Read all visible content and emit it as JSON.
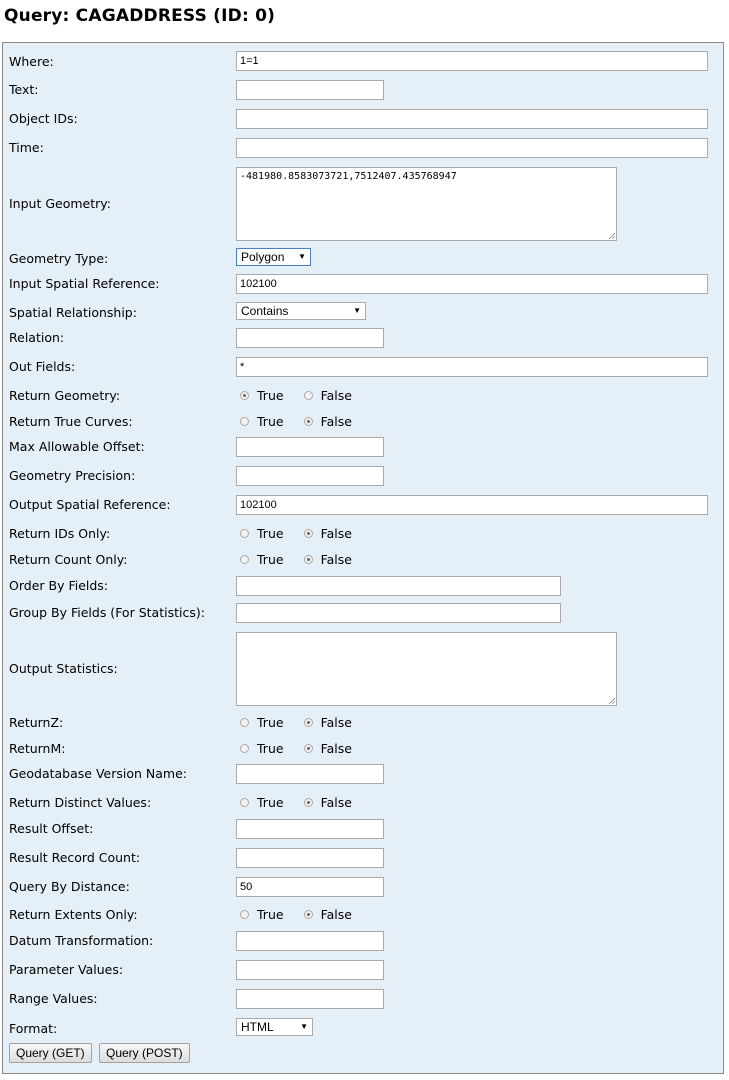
{
  "page": {
    "title": "Query: CAGADDRESS (ID: 0)"
  },
  "form": {
    "where": {
      "label": "Where:",
      "value": "1=1"
    },
    "text": {
      "label": "Text:",
      "value": ""
    },
    "object_ids": {
      "label": "Object IDs:",
      "value": ""
    },
    "time": {
      "label": "Time:",
      "value": ""
    },
    "input_geometry": {
      "label": "Input Geometry:",
      "value": "-481980.8583073721,7512407.435768947"
    },
    "geometry_type": {
      "label": "Geometry Type:",
      "selected": "Polygon"
    },
    "input_spatial_reference": {
      "label": "Input Spatial Reference:",
      "value": "102100"
    },
    "spatial_relationship": {
      "label": "Spatial Relationship:",
      "selected": "Contains"
    },
    "relation": {
      "label": "Relation:",
      "value": ""
    },
    "out_fields": {
      "label": "Out Fields:",
      "value": "*"
    },
    "return_geometry": {
      "label": "Return Geometry:",
      "true_label": "True",
      "false_label": "False",
      "selected": "True"
    },
    "return_true_curves": {
      "label": "Return True Curves:",
      "true_label": "True",
      "false_label": "False",
      "selected": "False"
    },
    "max_allowable_offset": {
      "label": "Max Allowable Offset:",
      "value": ""
    },
    "geometry_precision": {
      "label": "Geometry Precision:",
      "value": ""
    },
    "output_spatial_reference": {
      "label": "Output Spatial Reference:",
      "value": "102100"
    },
    "return_ids_only": {
      "label": "Return IDs Only:",
      "true_label": "True",
      "false_label": "False",
      "selected": "False"
    },
    "return_count_only": {
      "label": "Return Count Only:",
      "true_label": "True",
      "false_label": "False",
      "selected": "False"
    },
    "order_by_fields": {
      "label": "Order By Fields:",
      "value": ""
    },
    "group_by_fields": {
      "label": "Group By Fields (For Statistics):",
      "value": ""
    },
    "output_statistics": {
      "label": "Output Statistics:",
      "value": ""
    },
    "return_z": {
      "label": "ReturnZ:",
      "true_label": "True",
      "false_label": "False",
      "selected": "False"
    },
    "return_m": {
      "label": "ReturnM:",
      "true_label": "True",
      "false_label": "False",
      "selected": "False"
    },
    "gdb_version": {
      "label": "Geodatabase Version Name:",
      "value": ""
    },
    "return_distinct_values": {
      "label": "Return Distinct Values:",
      "true_label": "True",
      "false_label": "False",
      "selected": "False"
    },
    "result_offset": {
      "label": "Result Offset:",
      "value": ""
    },
    "result_record_count": {
      "label": "Result Record Count:",
      "value": ""
    },
    "query_by_distance": {
      "label": "Query By Distance:",
      "value": "50"
    },
    "return_extents_only": {
      "label": "Return Extents Only:",
      "true_label": "True",
      "false_label": "False",
      "selected": "False"
    },
    "datum_transformation": {
      "label": "Datum Transformation:",
      "value": ""
    },
    "parameter_values": {
      "label": "Parameter Values:",
      "value": ""
    },
    "range_values": {
      "label": "Range Values:",
      "value": ""
    },
    "format": {
      "label": "Format:",
      "selected": "HTML"
    }
  },
  "buttons": {
    "query_get": "Query (GET)",
    "query_post": "Query (POST)"
  },
  "icons": {
    "dropdown": "dropdown-arrow-icon",
    "resize": "resize-grip-icon"
  }
}
